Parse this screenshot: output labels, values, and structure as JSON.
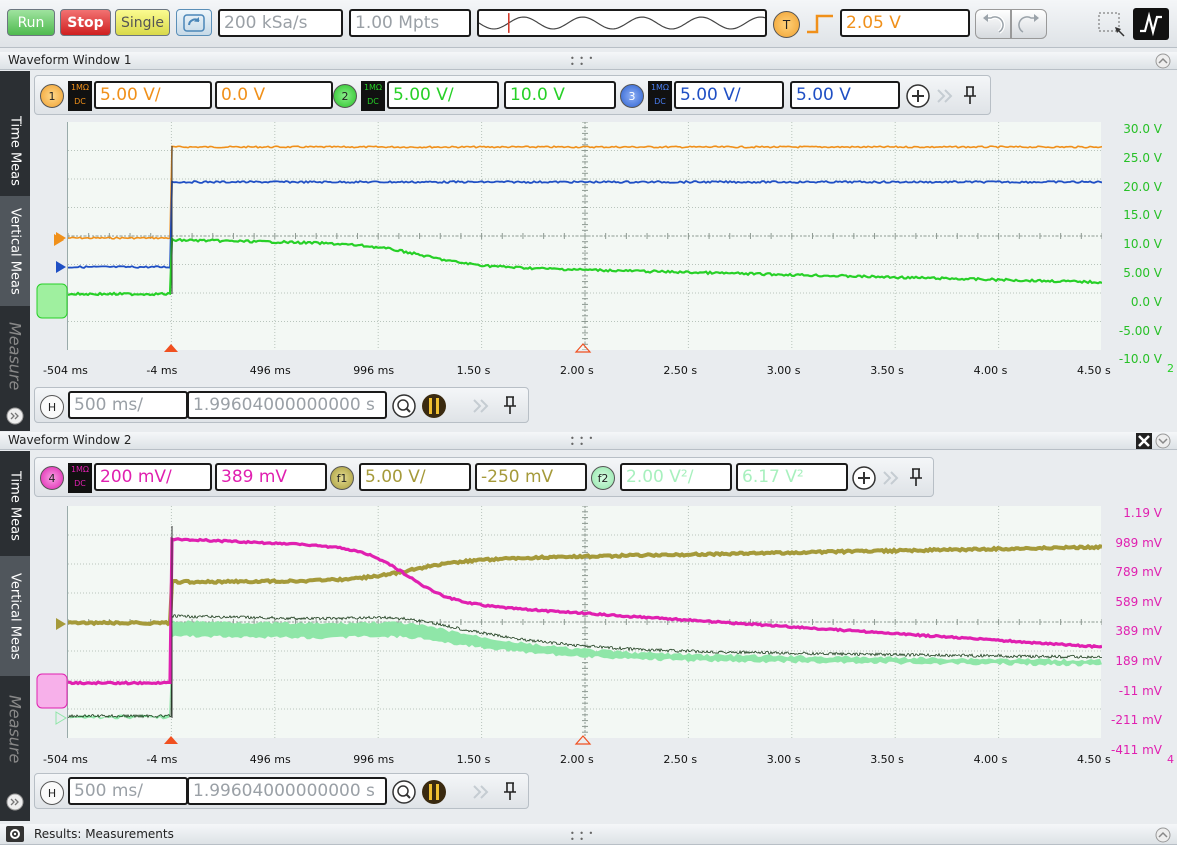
{
  "toolbar": {
    "run_label": "Run",
    "stop_label": "Stop",
    "single_label": "Single",
    "sample_rate": "200 kSa/s",
    "memory_depth": "1.00 Mpts",
    "trigger_badge": "T",
    "trigger_level": "2.05 V"
  },
  "colors": {
    "ch1": "#f0901a",
    "ch2": "#27d027",
    "ch3": "#1f4fc4",
    "ch4": "#e020b0",
    "f1": "#a59a3a",
    "f2": "#8fe6a8"
  },
  "window1": {
    "title": "Waveform Window 1",
    "side_tabs": [
      "Time Meas",
      "Vertical Meas",
      "Measure"
    ],
    "channels": [
      {
        "badge": "1",
        "coupling_top": "1MΩ",
        "coupling_bottom": "DC",
        "scale": "5.00 V/",
        "offset": "0.0 V"
      },
      {
        "badge": "2",
        "coupling_top": "1MΩ",
        "coupling_bottom": "DC",
        "scale": "5.00 V/",
        "offset": "10.0 V"
      },
      {
        "badge": "3",
        "coupling_top": "1MΩ",
        "coupling_bottom": "DC",
        "scale": "5.00 V/",
        "offset": "5.00 V"
      }
    ],
    "y_labels": [
      "30.0 V",
      "25.0 V",
      "20.0 V",
      "15.0 V",
      "10.0 V",
      "5.00 V",
      "0.0 V",
      "-5.00 V",
      "-10.0 V"
    ],
    "x_labels": [
      "-504 ms",
      "-4 ms",
      "496 ms",
      "996 ms",
      "1.50 s",
      "2.00 s",
      "2.50 s",
      "3.00 s",
      "3.50 s",
      "4.00 s",
      "4.50 s"
    ],
    "x_suffix": "2",
    "horiz_badge": "H",
    "horiz_scale": "500 ms/",
    "horiz_position": "1.99604000000000 s",
    "trigger_marker": "T"
  },
  "window2": {
    "title": "Waveform Window 2",
    "side_tabs": [
      "Time Meas",
      "Vertical Meas",
      "Measure"
    ],
    "channels": [
      {
        "badge": "4",
        "coupling_top": "1MΩ",
        "coupling_bottom": "DC",
        "scale": "200 mV/",
        "offset": "389 mV"
      },
      {
        "badge": "f1",
        "scale": "5.00 V/",
        "offset": "-250 mV"
      },
      {
        "badge": "f2",
        "scale": "2.00 V²/",
        "offset": "6.17 V²"
      }
    ],
    "y_labels": [
      "1.19 V",
      "989 mV",
      "789 mV",
      "589 mV",
      "389 mV",
      "189 mV",
      "-11 mV",
      "-211 mV",
      "-411 mV"
    ],
    "x_labels": [
      "-504 ms",
      "-4 ms",
      "496 ms",
      "996 ms",
      "1.50 s",
      "2.00 s",
      "2.50 s",
      "3.00 s",
      "3.50 s",
      "4.00 s",
      "4.50 s"
    ],
    "x_suffix": "4",
    "horiz_badge": "H",
    "horiz_scale": "500 ms/",
    "horiz_position": "1.99604000000000 s"
  },
  "results": {
    "title": "Results: Measurements"
  }
}
